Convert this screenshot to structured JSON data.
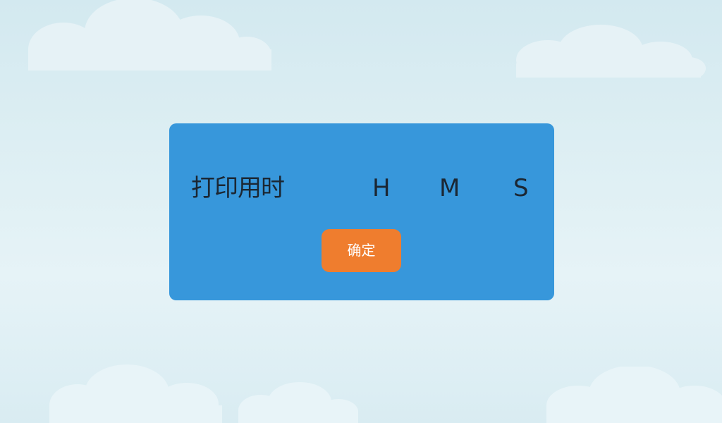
{
  "background": {
    "top_color": "#d3e9f0",
    "bottom_color": "#e6f3f7",
    "cloud_color": "#eef7fa",
    "decoration": "cloud-shapes"
  },
  "dialog": {
    "background_color": "#3797db",
    "label": "打印用时",
    "units": {
      "hours": "H",
      "minutes": "M",
      "seconds": "S"
    },
    "confirm_button": {
      "label": "确定",
      "color": "#ef7d2e"
    }
  }
}
